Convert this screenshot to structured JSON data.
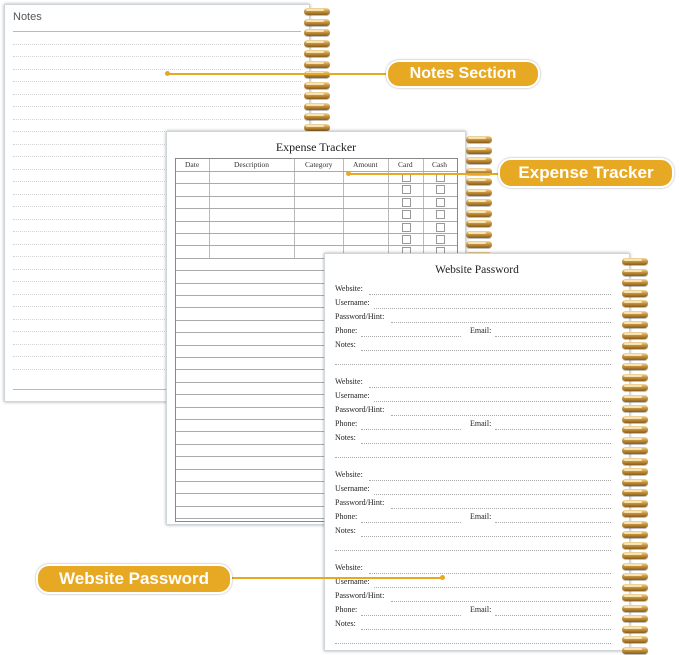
{
  "notes_page": {
    "title": "Notes"
  },
  "expense_page": {
    "title": "Expense Tracker",
    "columns": [
      "Date",
      "Description",
      "Category",
      "Amount",
      "Card",
      "Cash"
    ]
  },
  "password_page": {
    "title": "Website Password",
    "labels": {
      "website": "Website:",
      "username": "Username:",
      "password_hint": "Password/Hint:",
      "phone": "Phone:",
      "email": "Email:",
      "notes": "Notes:"
    }
  },
  "callouts": {
    "notes_section": "Notes Section",
    "expense_tracker": "Expense Tracker",
    "website_password": "Website Password"
  },
  "colors": {
    "accent": "#e7a924",
    "spiral": "#c99640"
  }
}
